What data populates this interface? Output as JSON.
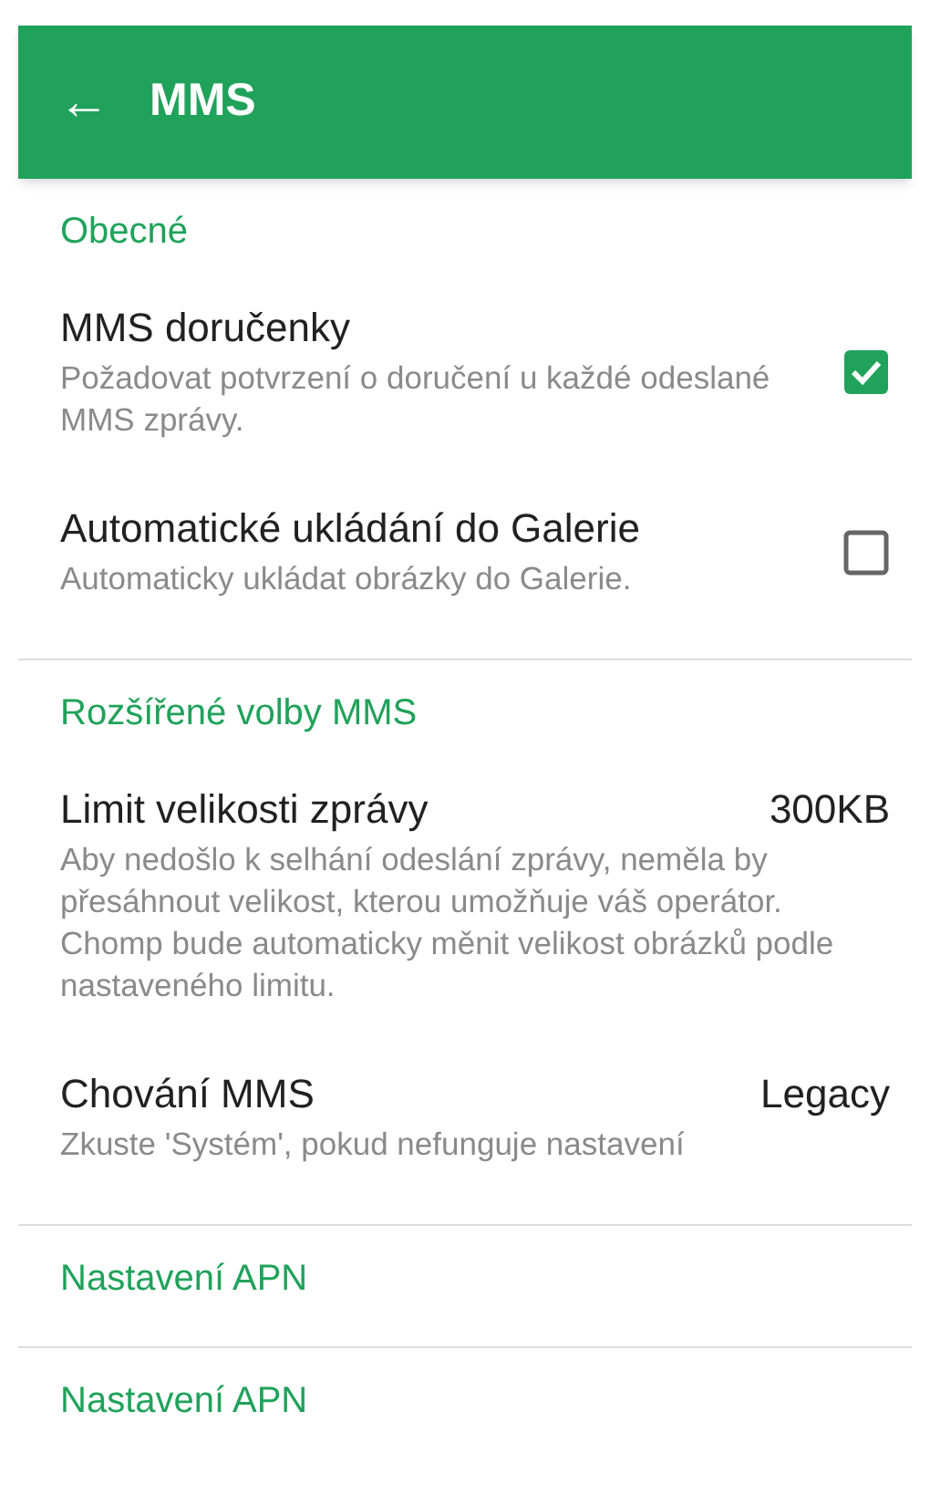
{
  "toolbar": {
    "back_icon": "←",
    "title": "MMS"
  },
  "sections": [
    {
      "title": "Obecné",
      "items": [
        {
          "kind": "checkbox",
          "title": "MMS doručenky",
          "summary": "Požadovat potvrzení o doručení u každé odeslané MMS zprávy.",
          "checked": true
        },
        {
          "kind": "checkbox",
          "title": "Automatické ukládání do Galerie",
          "summary": "Automaticky ukládat obrázky do Galerie.",
          "checked": false
        }
      ]
    },
    {
      "title": "Rozšířené volby MMS",
      "items": [
        {
          "kind": "value",
          "title": "Limit velikosti zprávy",
          "value": "300KB",
          "summary": "Aby nedošlo k selhání odeslání zprávy, neměla by přesáhnout velikost, kterou umožňuje váš operátor. Chomp bude automaticky měnit velikost obrázků podle nastaveného limitu."
        },
        {
          "kind": "value",
          "title": "Chování MMS",
          "value": "Legacy",
          "summary": "Zkuste 'Systém', pokud nefunguje nastavení"
        }
      ]
    },
    {
      "title": "Nastavení APN"
    },
    {
      "title": "Nastavení APN"
    }
  ]
}
